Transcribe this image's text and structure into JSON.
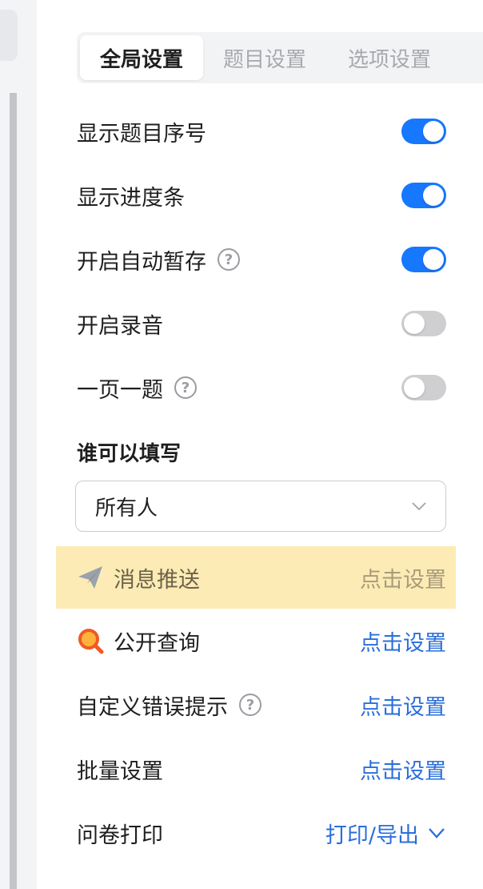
{
  "tabs": [
    {
      "label": "全局设置",
      "active": true
    },
    {
      "label": "题目设置",
      "active": false
    },
    {
      "label": "选项设置",
      "active": false
    }
  ],
  "toggles": [
    {
      "label": "显示题目序号",
      "on": true,
      "has_help": false
    },
    {
      "label": "显示进度条",
      "on": true,
      "has_help": false
    },
    {
      "label": "开启自动暂存",
      "on": true,
      "has_help": true
    },
    {
      "label": "开启录音",
      "on": false,
      "has_help": false
    },
    {
      "label": "一页一题",
      "on": false,
      "has_help": true
    }
  ],
  "who_can_fill": {
    "title": "谁可以填写",
    "selected": "所有人"
  },
  "settings_rows": [
    {
      "label": "消息推送",
      "action": "点击设置",
      "icon": "paper-plane-icon",
      "highlighted": true
    },
    {
      "label": "公开查询",
      "action": "点击设置",
      "icon": "magnifier-icon",
      "highlighted": false
    },
    {
      "label": "自定义错误提示",
      "action": "点击设置",
      "icon": "help-icon",
      "highlighted": false
    },
    {
      "label": "批量设置",
      "action": "点击设置",
      "icon": "",
      "highlighted": false
    },
    {
      "label": "问卷打印",
      "action": "打印/导出",
      "icon": "chevron-down-icon",
      "highlighted": false
    }
  ],
  "colors": {
    "accent": "#1677ff",
    "link": "#2b6fdb",
    "highlight_bg": "#fdebb6"
  }
}
